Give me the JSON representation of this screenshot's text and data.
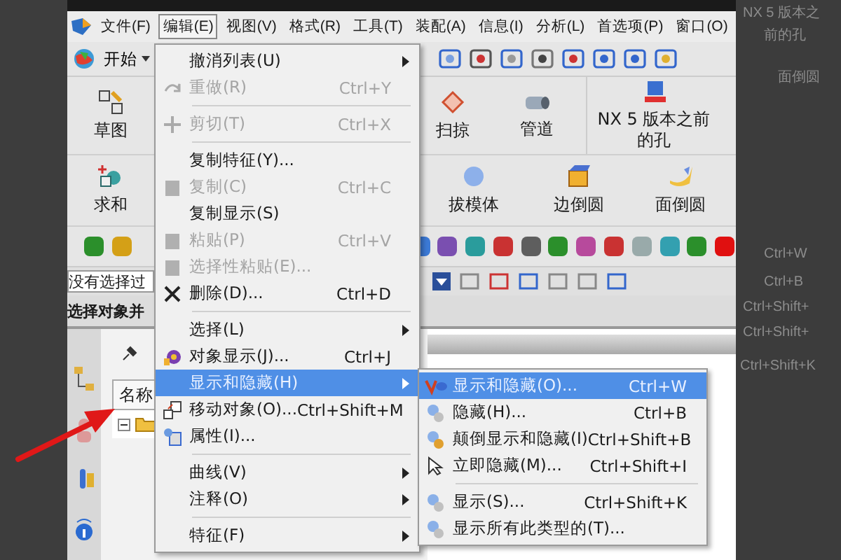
{
  "menubar": [
    {
      "label": "文件(F)",
      "selected": false
    },
    {
      "label": "编辑(E)",
      "selected": true
    },
    {
      "label": "视图(V)",
      "selected": false
    },
    {
      "label": "格式(R)",
      "selected": false
    },
    {
      "label": "工具(T)",
      "selected": false
    },
    {
      "label": "装配(A)",
      "selected": false
    },
    {
      "label": "信息(I)",
      "selected": false
    },
    {
      "label": "分析(L)",
      "selected": false
    },
    {
      "label": "首选项(P)",
      "selected": false
    },
    {
      "label": "窗口(O)",
      "selected": false
    }
  ],
  "toolbar": {
    "start_label": "开始"
  },
  "ribbon_row_1": [
    {
      "label": "草图"
    },
    {
      "label": "扫掠"
    },
    {
      "label": "管道"
    },
    {
      "label": "NX 5 版本之前的孔"
    }
  ],
  "ribbon_row_2": [
    {
      "label": "求和"
    },
    {
      "label": "拔模体"
    },
    {
      "label": "边倒圆"
    },
    {
      "label": "面倒圆"
    }
  ],
  "selection_filter": {
    "value": "没有选择过"
  },
  "prompt": "选择对象并",
  "navigator": {
    "column_header": "名称"
  },
  "edit_menu": [
    {
      "kind": "item",
      "label": "撤消列表(U)",
      "submenu": true,
      "disabled": false,
      "selected": false
    },
    {
      "kind": "item",
      "label": "重做(R)",
      "shortcut": "Ctrl+Y",
      "submenu": false,
      "disabled": true,
      "selected": false
    },
    {
      "kind": "separator"
    },
    {
      "kind": "item",
      "label": "剪切(T)",
      "shortcut": "Ctrl+X",
      "submenu": false,
      "disabled": true,
      "selected": false
    },
    {
      "kind": "separator"
    },
    {
      "kind": "item",
      "label": "复制特征(Y)...",
      "submenu": false,
      "disabled": false,
      "selected": false
    },
    {
      "kind": "item",
      "label": "复制(C)",
      "shortcut": "Ctrl+C",
      "submenu": false,
      "disabled": true,
      "selected": false
    },
    {
      "kind": "item",
      "label": "复制显示(S)",
      "submenu": false,
      "disabled": false,
      "selected": false
    },
    {
      "kind": "item",
      "label": "粘贴(P)",
      "shortcut": "Ctrl+V",
      "submenu": false,
      "disabled": true,
      "selected": false
    },
    {
      "kind": "item",
      "label": "选择性粘贴(E)...",
      "submenu": false,
      "disabled": true,
      "selected": false
    },
    {
      "kind": "item",
      "label": "删除(D)...",
      "shortcut": "Ctrl+D",
      "submenu": false,
      "disabled": false,
      "selected": false
    },
    {
      "kind": "separator"
    },
    {
      "kind": "item",
      "label": "选择(L)",
      "submenu": true,
      "disabled": false,
      "selected": false
    },
    {
      "kind": "item",
      "label": "对象显示(J)...",
      "shortcut": "Ctrl+J",
      "submenu": false,
      "disabled": false,
      "selected": false
    },
    {
      "kind": "item",
      "label": "显示和隐藏(H)",
      "submenu": true,
      "disabled": false,
      "selected": true
    },
    {
      "kind": "item",
      "label": "移动对象(O)...",
      "shortcut": "Ctrl+Shift+M",
      "submenu": false,
      "disabled": false,
      "selected": false
    },
    {
      "kind": "item",
      "label": "属性(I)...",
      "submenu": false,
      "disabled": false,
      "selected": false
    },
    {
      "kind": "separator"
    },
    {
      "kind": "item",
      "label": "曲线(V)",
      "submenu": true,
      "disabled": false,
      "selected": false
    },
    {
      "kind": "item",
      "label": "注释(O)",
      "submenu": true,
      "disabled": false,
      "selected": false
    },
    {
      "kind": "separator"
    },
    {
      "kind": "item",
      "label": "特征(F)",
      "submenu": true,
      "disabled": false,
      "selected": false
    }
  ],
  "show_hide_submenu": [
    {
      "kind": "item",
      "label": "显示和隐藏(O)...",
      "shortcut": "Ctrl+W",
      "selected": true
    },
    {
      "kind": "item",
      "label": "隐藏(H)...",
      "shortcut": "Ctrl+B",
      "selected": false
    },
    {
      "kind": "item",
      "label": "颠倒显示和隐藏(I)",
      "shortcut": "Ctrl+Shift+B",
      "selected": false
    },
    {
      "kind": "item",
      "label": "立即隐藏(M)...",
      "shortcut": "Ctrl+Shift+I",
      "selected": false
    },
    {
      "kind": "separator"
    },
    {
      "kind": "item",
      "label": "显示(S)...",
      "shortcut": "Ctrl+Shift+K",
      "selected": false
    },
    {
      "kind": "item",
      "label": "显示所有此类型的(T)...",
      "selected": false
    }
  ],
  "backdrop_texts": [
    "NX 5 版本之",
    "前的孔",
    "面倒圆",
    "Ctrl+W",
    "Ctrl+B",
    "Ctrl+Shift+",
    "Ctrl+Shift+",
    "Ctrl+Shift+K"
  ]
}
